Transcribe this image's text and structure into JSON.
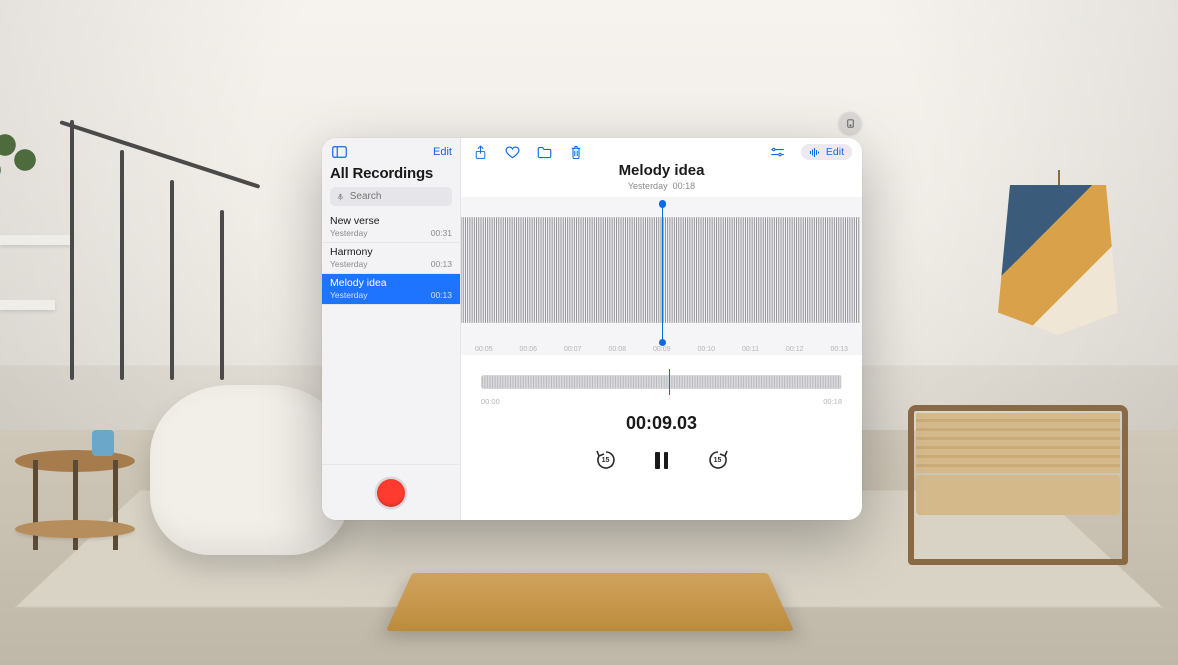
{
  "sidebar": {
    "edit_label": "Edit",
    "title": "All Recordings",
    "search_placeholder": "Search",
    "items": [
      {
        "title": "New verse",
        "date": "Yesterday",
        "duration": "00:31",
        "selected": false
      },
      {
        "title": "Harmony",
        "date": "Yesterday",
        "duration": "00:13",
        "selected": false
      },
      {
        "title": "Melody idea",
        "date": "Yesterday",
        "duration": "00:13",
        "selected": true
      }
    ]
  },
  "detail": {
    "title": "Melody idea",
    "subtitle_date": "Yesterday",
    "subtitle_duration": "00:18",
    "edit_label": "Edit",
    "timeline_ticks": [
      "00:05",
      "00:06",
      "00:07",
      "00:08",
      "00:09",
      "00:10",
      "00:11",
      "00:12",
      "00:13"
    ],
    "trimmer": {
      "start_label": "00:00",
      "end_label": "00:18"
    },
    "timecode": "00:09.03",
    "skip_seconds": "15"
  },
  "colors": {
    "accent": "#0b6be8",
    "record": "#ff3b30"
  }
}
